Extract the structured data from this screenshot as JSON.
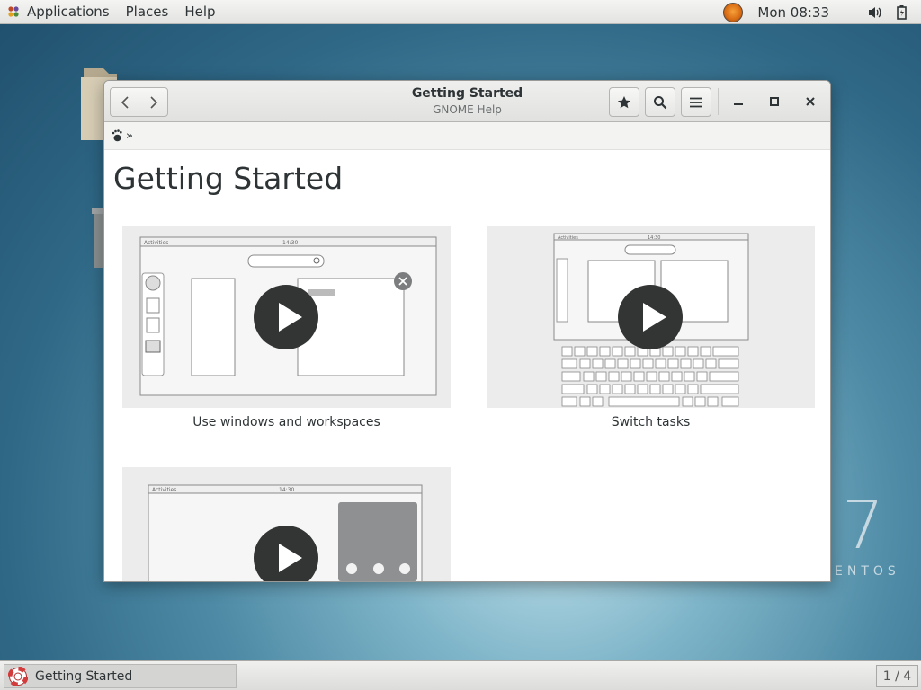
{
  "topbar": {
    "menus": [
      "Applications",
      "Places",
      "Help"
    ],
    "clock": "Mon 08:33"
  },
  "desktop": {
    "watermark_number": "7",
    "watermark_text": "ENTOS"
  },
  "window": {
    "title": "Getting Started",
    "subtitle": "GNOME Help",
    "breadcrumb_sep": "»",
    "page_title": "Getting Started",
    "cards": [
      {
        "caption": "Use windows and workspaces",
        "mock_label": "Activities",
        "mock_time": "14:30"
      },
      {
        "caption": "Switch tasks",
        "mock_label": "Activities",
        "mock_time": "14:30"
      },
      {
        "caption": "",
        "mock_label": "Activities",
        "mock_time": "14:30"
      }
    ]
  },
  "taskbar": {
    "task_label": "Getting Started",
    "workspace": "1 / 4"
  },
  "colors": {
    "accent_dark": "#333434",
    "text": "#2e3436"
  }
}
